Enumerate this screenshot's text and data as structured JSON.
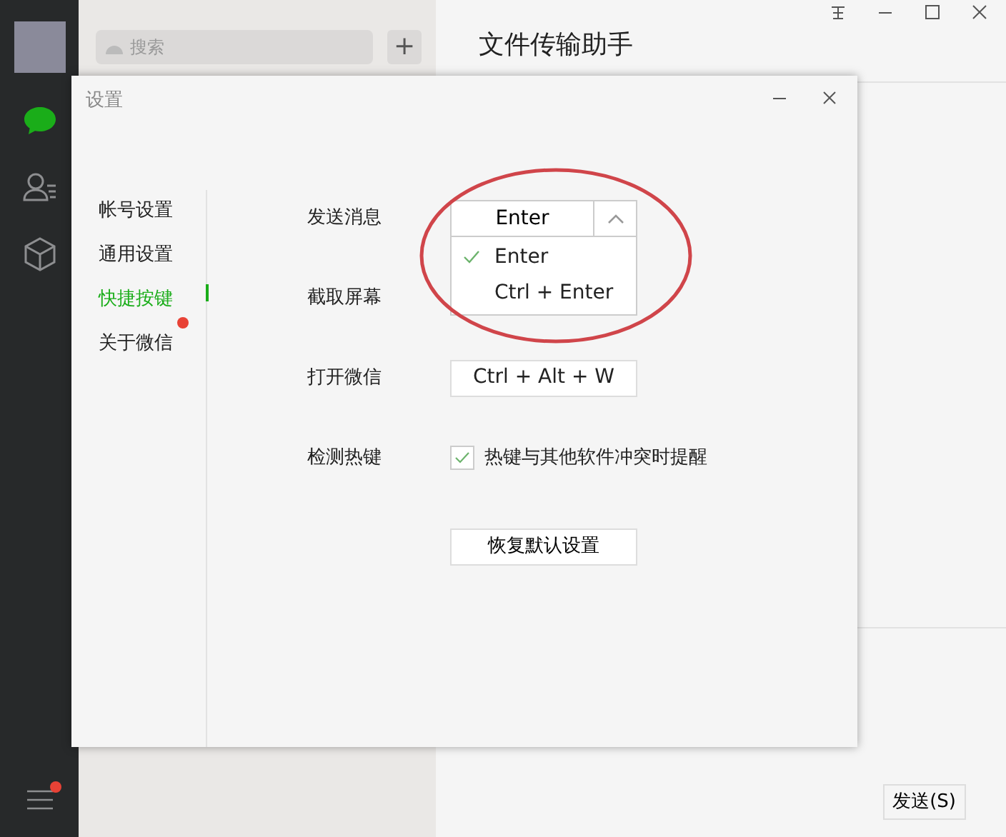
{
  "sidebar": {
    "nav": [
      {
        "kind": "chat",
        "selected": true
      },
      {
        "kind": "contacts",
        "selected": false
      },
      {
        "kind": "favorites",
        "selected": false
      }
    ],
    "menu_badge": true
  },
  "list_panel": {
    "search": {
      "placeholder": "搜索"
    },
    "add_button": "+"
  },
  "chat": {
    "title": "文件传输助手",
    "send_button": "发送(S)"
  },
  "dialog": {
    "title": "设置",
    "nav": [
      {
        "label": "帐号设置",
        "selected": false,
        "badge": false
      },
      {
        "label": "通用设置",
        "selected": false,
        "badge": false
      },
      {
        "label": "快捷按键",
        "selected": true,
        "badge": false
      },
      {
        "label": "关于微信",
        "selected": false,
        "badge": true
      }
    ],
    "rows": [
      {
        "kind": "dropdown",
        "label": "发送消息",
        "value": "Enter",
        "expanded": true,
        "options": [
          {
            "label": "Enter",
            "selected": true
          },
          {
            "label": "Ctrl + Enter",
            "selected": false
          }
        ]
      },
      {
        "kind": "hidden",
        "label": "截取屏幕"
      },
      {
        "kind": "hotkey",
        "label": "打开微信",
        "value": "Ctrl + Alt + W"
      },
      {
        "kind": "checkbox",
        "label": "检测热键",
        "text": "热键与其他软件冲突时提醒",
        "checked": true
      }
    ],
    "reset_button": "恢复默认设置"
  }
}
